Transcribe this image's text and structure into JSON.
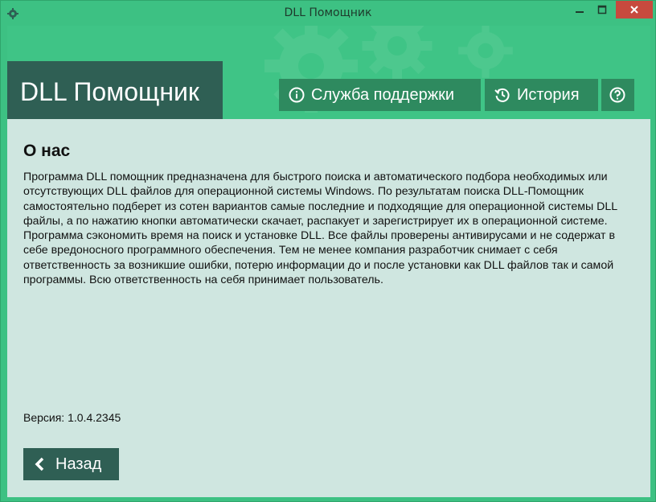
{
  "window": {
    "title": "DLL Помощник"
  },
  "header": {
    "brand": "DLL Помощник",
    "support_label": "Служба поддержки",
    "history_label": "История"
  },
  "about": {
    "title": "О нас",
    "text": "Программа DLL помощник предназначена для быстрого поиска и автоматического подбора необходимых или отсутствующих DLL файлов для операционной системы Windows. По результатам поиска DLL-Помощник самостоятельно подберет из сотен вариантов самые последние и подходящие для операционной системы DLL файлы, а по нажатию кнопки автоматически скачает, распакует и зарегистрирует их в операционной системе. Программа сэкономить время на поиск и установке DLL. Все файлы проверены антивирусами и не содержат в себе вредоносного программного обеспечения. Тем не менее компания разработчик снимает с себя ответственность за возникшие ошибки, потерю информации до и после установки как DLL файлов так и самой программы. Всю ответственность на себя принимает пользователь.",
    "version_label": "Версия:",
    "version_value": "1.0.4.2345"
  },
  "footer": {
    "back_label": "Назад"
  },
  "icons": {
    "app": "gear-icon",
    "support": "info-icon",
    "history": "history-icon",
    "help": "help-icon",
    "back": "chevron-left-icon"
  },
  "colors": {
    "accent_green": "#3dc183",
    "dark_teal": "#2f5f54",
    "button_green": "#2e8a5f",
    "content_bg": "#cfe6e0",
    "close_red": "#c74a3e"
  }
}
